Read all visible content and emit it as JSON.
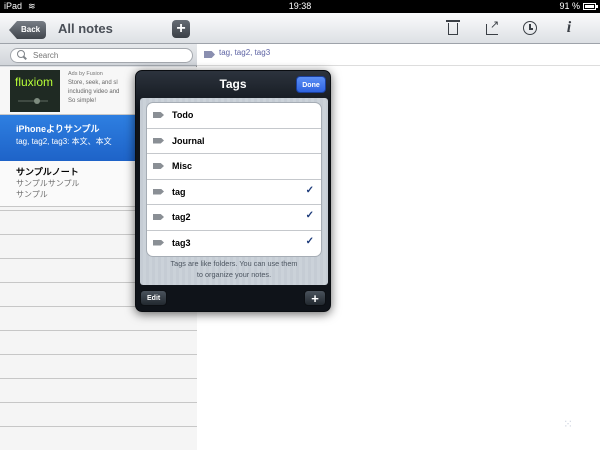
{
  "status_bar": {
    "device": "iPad",
    "time": "19:38",
    "battery": "91 %"
  },
  "left_nav": {
    "back_label": "Back",
    "title": "All notes",
    "add_label": "+"
  },
  "search": {
    "placeholder": "Search"
  },
  "ad": {
    "logo": "fluxiom",
    "by": "Ads by Fusion",
    "lines": [
      "Store, seek, and sl",
      "including video and",
      "So simple!"
    ]
  },
  "notes": [
    {
      "title": "iPhoneよりサンプル",
      "lines": [
        "tag, tag2, tag3: 本文、本文"
      ],
      "selected": true
    },
    {
      "title": "サンプルノート",
      "lines": [
        "サンプルサンプル",
        "サンプル"
      ],
      "selected": false
    }
  ],
  "toolbar": {
    "info_label": "i"
  },
  "note_tags": "tag, tag2, tag3",
  "popover": {
    "title": "Tags",
    "done_label": "Done",
    "tags": [
      {
        "name": "Todo",
        "checked": false
      },
      {
        "name": "Journal",
        "checked": false
      },
      {
        "name": "Misc",
        "checked": false
      },
      {
        "name": "tag",
        "checked": true
      },
      {
        "name": "tag2",
        "checked": true
      },
      {
        "name": "tag3",
        "checked": true
      }
    ],
    "check_mark": "✓",
    "hint": [
      "Tags are like folders. You can use them",
      "to organize your notes."
    ],
    "edit_label": "Edit",
    "add_label": "+"
  },
  "colors": {
    "accent": "#2e63e0",
    "selection": "#2370d8",
    "tag_link": "#5c62a3"
  },
  "icons": [
    "wifi-icon",
    "battery-icon",
    "search-icon",
    "trash-icon",
    "share-icon",
    "clock-icon",
    "info-icon",
    "tag-icon",
    "checkmark-icon",
    "resize-icon"
  ]
}
